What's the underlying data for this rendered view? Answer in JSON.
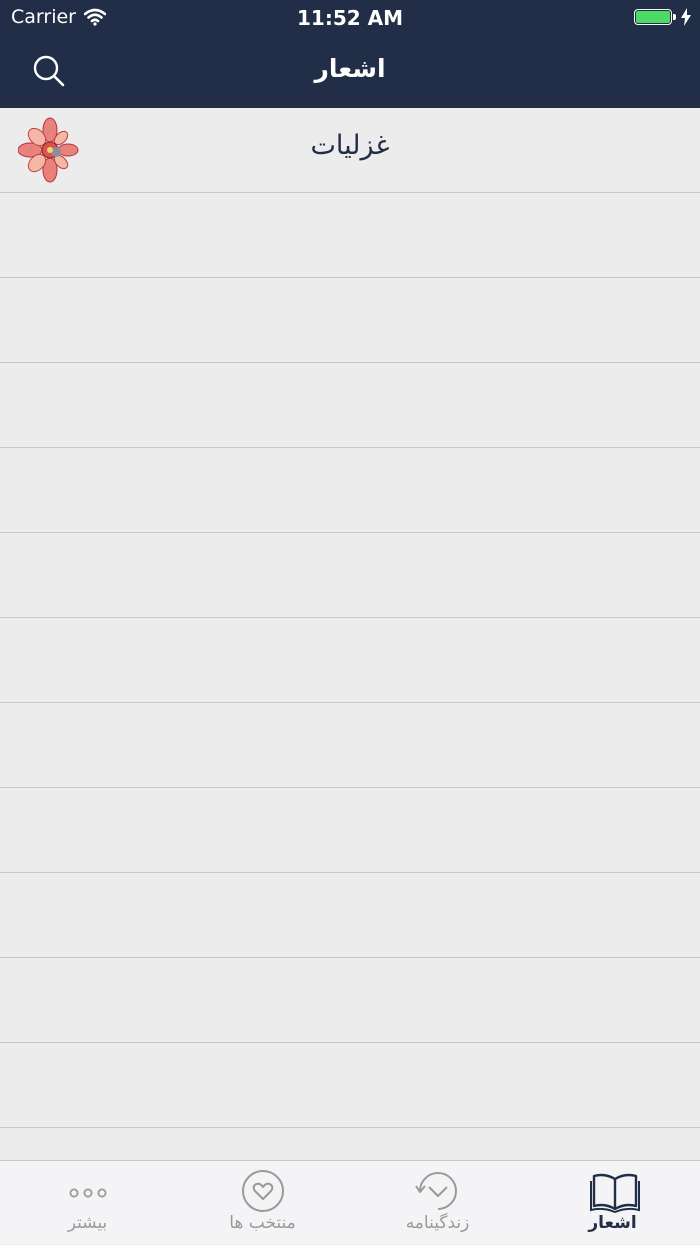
{
  "status_bar": {
    "carrier": "Carrier",
    "time": "11:52 AM",
    "battery_level": 1.0,
    "battery_color": "#4cd964"
  },
  "nav_bar": {
    "title": "اشعار",
    "search_icon": "search-icon",
    "background": "#222e47"
  },
  "list": {
    "rows": [
      {
        "title": "غزلیات",
        "icon": "floral-ornament-icon"
      },
      {
        "title": ""
      },
      {
        "title": ""
      },
      {
        "title": ""
      },
      {
        "title": ""
      },
      {
        "title": ""
      },
      {
        "title": ""
      },
      {
        "title": ""
      },
      {
        "title": ""
      },
      {
        "title": ""
      },
      {
        "title": ""
      },
      {
        "title": ""
      },
      {
        "title": ""
      }
    ]
  },
  "tab_bar": {
    "tabs": [
      {
        "label": "بیشتر",
        "icon": "more-dots-icon",
        "active": false
      },
      {
        "label": "منتخب ها",
        "icon": "heart-circle-icon",
        "active": false
      },
      {
        "label": "زندگینامه",
        "icon": "history-clock-icon",
        "active": false
      },
      {
        "label": "اشعار",
        "icon": "open-book-icon",
        "active": true
      }
    ],
    "active_color": "#222e47",
    "inactive_color": "#9a9a9a"
  }
}
